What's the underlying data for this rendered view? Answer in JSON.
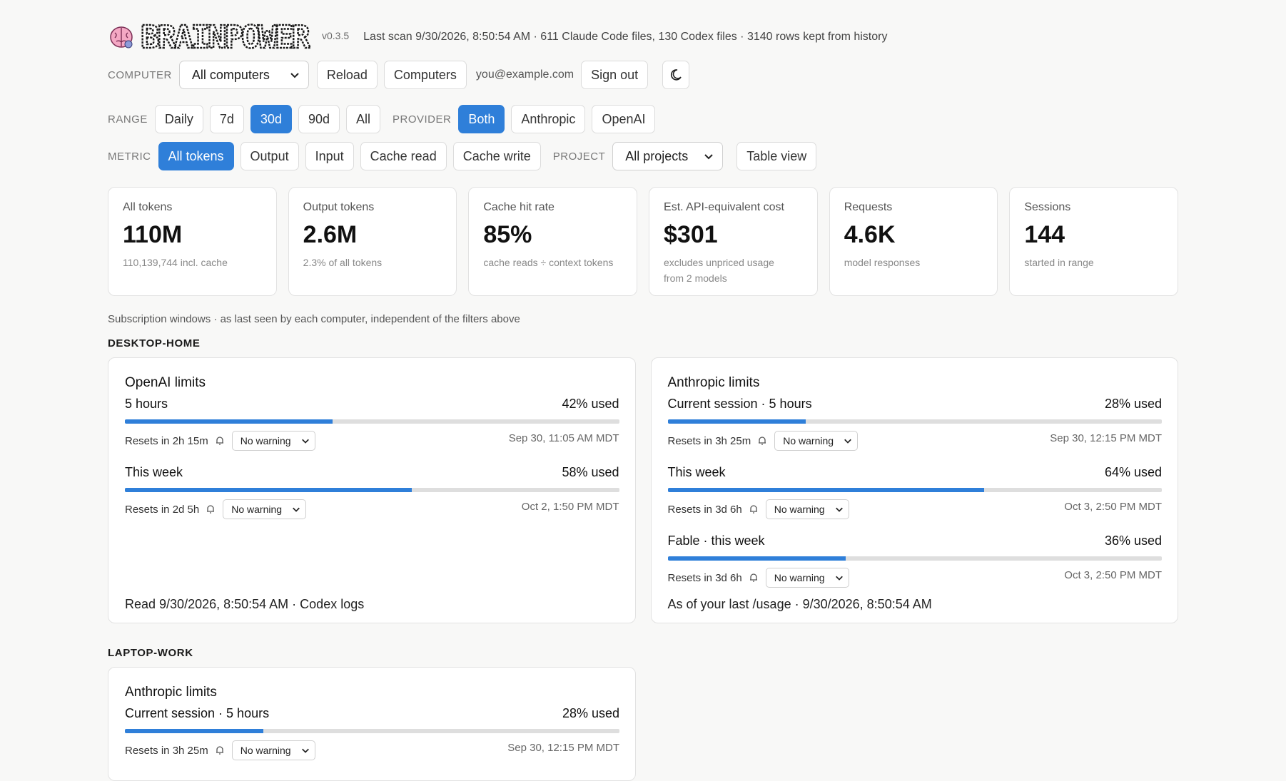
{
  "header": {
    "logo_text": "BRAINPOWER",
    "version": "v0.3.5",
    "scan": "Last scan 9/30/2026, 8:50:54 AM · 611 Claude Code files, 130 Codex files · 3140 rows kept from history"
  },
  "computer": {
    "label": "COMPUTER",
    "selected": "All computers",
    "reload": "Reload",
    "computers": "Computers",
    "email": "you@example.com",
    "signout": "Sign out",
    "theme_icon": "moon-icon"
  },
  "range": {
    "label": "RANGE",
    "options": [
      "Daily",
      "7d",
      "30d",
      "90d",
      "All"
    ],
    "selected": "30d"
  },
  "provider": {
    "label": "PROVIDER",
    "options": [
      "Both",
      "Anthropic",
      "OpenAI"
    ],
    "selected": "Both"
  },
  "metric": {
    "label": "METRIC",
    "options": [
      "All tokens",
      "Output",
      "Input",
      "Cache read",
      "Cache write"
    ],
    "selected": "All tokens"
  },
  "project": {
    "label": "PROJECT",
    "selected": "All projects",
    "table_view": "Table view"
  },
  "stats": [
    {
      "title": "All tokens",
      "value": "110M",
      "sub": "110,139,744 incl. cache"
    },
    {
      "title": "Output tokens",
      "value": "2.6M",
      "sub": "2.3% of all tokens"
    },
    {
      "title": "Cache hit rate",
      "value": "85%",
      "sub": "cache reads ÷ context tokens"
    },
    {
      "title": "Est. API-equivalent cost",
      "value": "$301",
      "sub": "excludes unpriced usage from 2 models"
    },
    {
      "title": "Requests",
      "value": "4.6K",
      "sub": "model responses"
    },
    {
      "title": "Sessions",
      "value": "144",
      "sub": "started in range"
    }
  ],
  "subnote": "Subscription windows · as last seen by each computer, independent of the filters above",
  "accent": "#2f7fd9",
  "sections": [
    {
      "name": "DESKTOP-HOME",
      "panels": [
        {
          "title": "OpenAI limits",
          "limits": [
            {
              "name": "5 hours",
              "used": "42% used",
              "fraction": 0.42,
              "reset": "Resets in 2h 15m",
              "warning": "No warning",
              "when": "Sep 30, 11:05 AM MDT"
            },
            {
              "name": "This week",
              "used": "58% used",
              "fraction": 0.58,
              "reset": "Resets in 2d 5h",
              "warning": "No warning",
              "when": "Oct 2, 1:50 PM MDT"
            }
          ],
          "footer": "Read 9/30/2026, 8:50:54 AM · Codex logs"
        },
        {
          "title": "Anthropic limits",
          "limits": [
            {
              "name": "Current session · 5 hours",
              "used": "28% used",
              "fraction": 0.28,
              "reset": "Resets in 3h 25m",
              "warning": "No warning",
              "when": "Sep 30, 12:15 PM MDT"
            },
            {
              "name": "This week",
              "used": "64% used",
              "fraction": 0.64,
              "reset": "Resets in 3d 6h",
              "warning": "No warning",
              "when": "Oct 3, 2:50 PM MDT"
            },
            {
              "name": "Fable · this week",
              "used": "36% used",
              "fraction": 0.36,
              "reset": "Resets in 3d 6h",
              "warning": "No warning",
              "when": "Oct 3, 2:50 PM MDT"
            }
          ],
          "footer": "As of your last /usage · 9/30/2026, 8:50:54 AM"
        }
      ]
    },
    {
      "name": "LAPTOP-WORK",
      "panels": [
        {
          "title": "Anthropic limits",
          "limits": [
            {
              "name": "Current session · 5 hours",
              "used": "28% used",
              "fraction": 0.28,
              "reset": "Resets in 3h 25m",
              "warning": "No warning",
              "when": "Sep 30, 12:15 PM MDT"
            }
          ],
          "footer": ""
        }
      ]
    }
  ]
}
